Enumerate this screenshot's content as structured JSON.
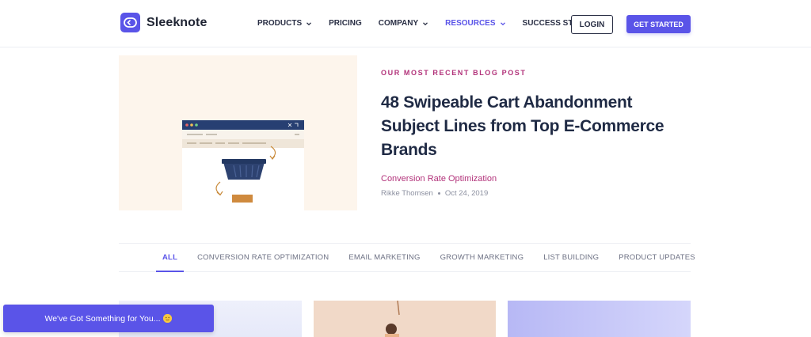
{
  "header": {
    "brand": "Sleeknote",
    "nav": [
      {
        "label": "PRODUCTS",
        "dropdown": true,
        "active": false
      },
      {
        "label": "PRICING",
        "dropdown": false,
        "active": false
      },
      {
        "label": "COMPANY",
        "dropdown": true,
        "active": false
      },
      {
        "label": "RESOURCES",
        "dropdown": true,
        "active": true
      },
      {
        "label": "SUCCESS STORIES",
        "dropdown": false,
        "active": false
      }
    ],
    "login_label": "LOGIN",
    "cta_label": "GET STARTED"
  },
  "featured": {
    "kicker": "OUR MOST RECENT BLOG POST",
    "title": "48 Swipeable Cart Abandonment Subject Lines from Top E-Commerce Brands",
    "category": "Conversion Rate Optimization",
    "author": "Rikke Thomsen",
    "date": "Oct 24, 2019",
    "image_icon": "cart-abandonment-illustration"
  },
  "filters": {
    "tabs": [
      {
        "label": "ALL",
        "active": true
      },
      {
        "label": "CONVERSION RATE OPTIMIZATION",
        "active": false
      },
      {
        "label": "EMAIL MARKETING",
        "active": false
      },
      {
        "label": "GROWTH MARKETING",
        "active": false
      },
      {
        "label": "LIST BUILDING",
        "active": false
      },
      {
        "label": "PRODUCT UPDATES",
        "active": false
      }
    ]
  },
  "toast": {
    "text": "We've Got Something for You...",
    "icon": "smile-emoji"
  },
  "colors": {
    "accent": "#5a54e8",
    "kicker": "#b2327a",
    "hero_bg": "#fdf5ec"
  }
}
